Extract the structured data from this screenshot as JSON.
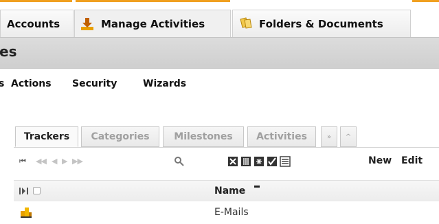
{
  "top_tabs": [
    {
      "label": "Accounts",
      "icon": "accounts-icon"
    },
    {
      "label": "Manage Activities",
      "icon": "download-icon"
    },
    {
      "label": "Folders & Documents",
      "icon": "folders-documents-icon"
    }
  ],
  "page": {
    "title": "es"
  },
  "sub_menu": {
    "partial": "s",
    "items": [
      "Actions",
      "Security",
      "Wizards"
    ]
  },
  "inner_tabs": [
    "Trackers",
    "Categories",
    "Milestones",
    "Activities",
    "»",
    "^"
  ],
  "toolbar": {
    "pager": [
      "first-page-icon",
      "previous-page-icon",
      "previous-icon",
      "next-icon",
      "last-page-icon"
    ],
    "search_icon": "search-icon",
    "tools": [
      "excel-export-icon",
      "column-chooser-icon",
      "filter-icon",
      "select-all-icon",
      "list-view-icon"
    ],
    "new_label": "New",
    "edit_label": "Edit"
  },
  "grid": {
    "columns": {
      "name": "Name"
    },
    "sort": "ascending",
    "rows": [
      {
        "icon": "tracker-folder-icon",
        "name": "E-Mails"
      }
    ]
  },
  "colors": {
    "accent": "#f0a020",
    "title_band": "#d4d4d4",
    "inactive_tab_text": "#a0a0a0"
  }
}
